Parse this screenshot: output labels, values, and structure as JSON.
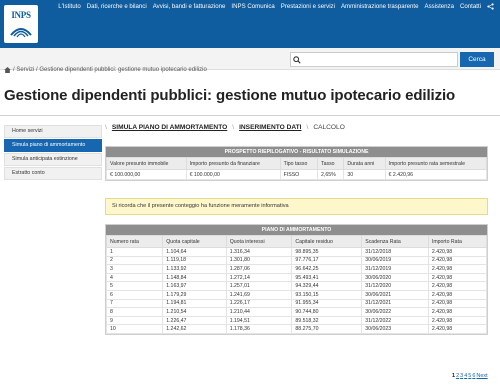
{
  "header": {
    "logo_text": "INPS",
    "nav": [
      "L'Istituto",
      "Dati, ricerche e bilanci",
      "Avvisi, bandi e fatturazione",
      "INPS Comunica",
      "Prestazioni e servizi",
      "Amministrazione trasparente",
      "Assistenza",
      "Contatti"
    ],
    "share_icon": "share-icon"
  },
  "search": {
    "placeholder": "",
    "button_label": "Cerca"
  },
  "breadcrumb": {
    "text": "/ Servizi / Gestione dipendenti pubblici: gestione mutuo ipotecario edilizio"
  },
  "page_title": "Gestione dipendenti pubblici: gestione mutuo ipotecario edilizio",
  "sidebar": {
    "items": [
      {
        "label": "Home servizi"
      },
      {
        "label": "Simula piano di ammortamento"
      },
      {
        "label": "Simula anticipata estinzione"
      },
      {
        "label": "Estratto conto"
      }
    ],
    "active_index": 1
  },
  "steps": {
    "step1": "SIMULA PIANO DI AMMORTAMENTO",
    "step2": "INSERIMENTO DATI",
    "step3": "CALCOLO"
  },
  "summary": {
    "title": "PROSPETTO RIEPILOGATIVO - RISULTATO SIMULAZIONE",
    "headers": [
      "Valore presunto immobile",
      "Importo presunto da finanziare",
      "Tipo tasso",
      "Tasso",
      "Durata anni",
      "Importo presunto rata semestrale"
    ],
    "row": [
      "€ 100.000,00",
      "€ 100.000,00",
      "FISSO",
      "2,65%",
      "30",
      "€ 2.420,96"
    ]
  },
  "notice": "Si ricorda che il presente conteggio ha funzione meramente informativa",
  "amortization": {
    "title": "PIANO DI AMMORTAMENTO",
    "headers": [
      "Numero rata",
      "Quota capitale",
      "Quota interessi",
      "Capitale residuo",
      "Scadenza Rata",
      "Importo Rata"
    ],
    "rows": [
      [
        "1",
        "1.104,64",
        "1.316,34",
        "98.895,35",
        "31/12/2018",
        "2.420,98"
      ],
      [
        "2",
        "1.119,18",
        "1.301,80",
        "97.776,17",
        "30/06/2019",
        "2.420,98"
      ],
      [
        "3",
        "1.133,92",
        "1.287,06",
        "96.642,25",
        "31/12/2019",
        "2.420,98"
      ],
      [
        "4",
        "1.148,84",
        "1.272,14",
        "95.493,41",
        "30/06/2020",
        "2.420,98"
      ],
      [
        "5",
        "1.163,97",
        "1.257,01",
        "94.329,44",
        "31/12/2020",
        "2.420,98"
      ],
      [
        "6",
        "1.179,29",
        "1.241,69",
        "93.150,15",
        "30/06/2021",
        "2.420,98"
      ],
      [
        "7",
        "1.194,81",
        "1.226,17",
        "91.955,34",
        "31/12/2021",
        "2.420,98"
      ],
      [
        "8",
        "1.210,54",
        "1.210,44",
        "90.744,80",
        "30/06/2022",
        "2.420,98"
      ],
      [
        "9",
        "1.226,47",
        "1.194,51",
        "89.518,32",
        "31/12/2022",
        "2.420,98"
      ],
      [
        "10",
        "1.242,62",
        "1.178,36",
        "88.275,70",
        "30/06/2023",
        "2.420,98"
      ]
    ]
  },
  "pagination": {
    "current": "1",
    "pages": [
      "2",
      "3",
      "4",
      "5",
      "6"
    ],
    "next": "Next"
  },
  "colors": {
    "brand": "#0f5c9e",
    "button": "#1666b0",
    "notice_bg": "#fff7cc"
  }
}
